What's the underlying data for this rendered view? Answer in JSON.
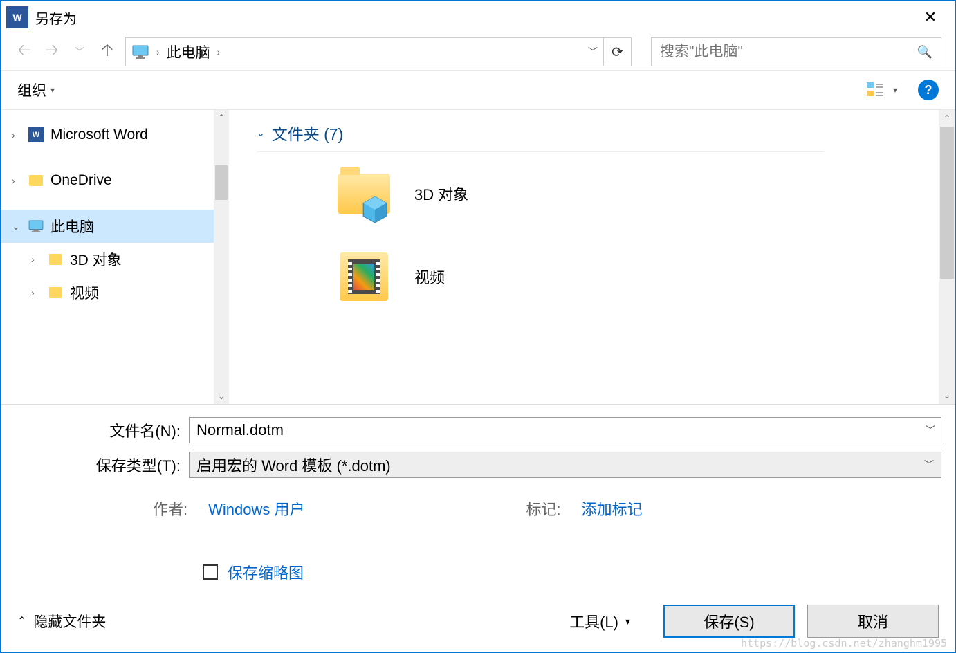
{
  "title": "另存为",
  "breadcrumb": {
    "location": "此电脑"
  },
  "search": {
    "placeholder": "搜索\"此电脑\""
  },
  "toolbar": {
    "organize": "组织"
  },
  "tree": {
    "word": "Microsoft Word",
    "onedrive": "OneDrive",
    "thispc": "此电脑",
    "obj3d": "3D 对象",
    "video": "视频"
  },
  "main": {
    "section_label": "文件夹 (7)",
    "items": {
      "obj3d": "3D 对象",
      "video": "视频"
    }
  },
  "form": {
    "filename_label": "文件名(N):",
    "filename_value": "Normal.dotm",
    "savetype_label": "保存类型(T):",
    "savetype_value": "启用宏的 Word 模板 (*.dotm)",
    "author_label": "作者:",
    "author_value": "Windows 用户",
    "tags_label": "标记:",
    "tags_value": "添加标记",
    "thumbnail_label": "保存缩略图"
  },
  "bottom": {
    "hide_folders": "隐藏文件夹",
    "tools": "工具(L)",
    "save": "保存(S)",
    "cancel": "取消"
  },
  "watermark": "https://blog.csdn.net/zhanghm1995"
}
